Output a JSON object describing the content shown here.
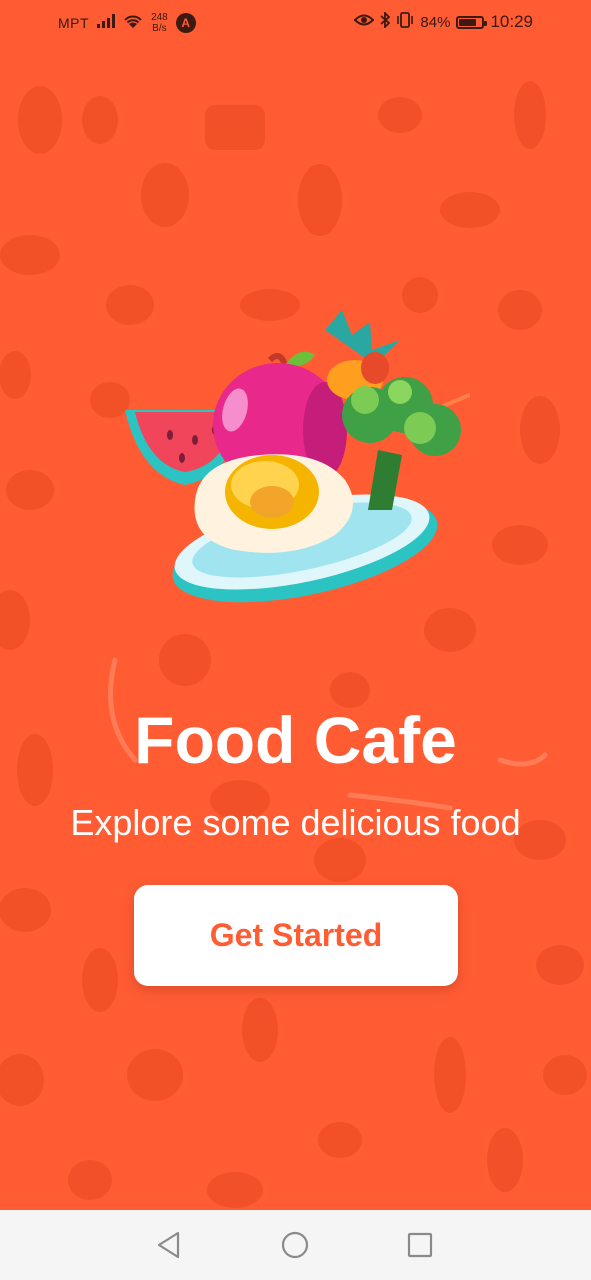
{
  "status_bar": {
    "carrier": "MPT",
    "speed_value": "248",
    "speed_unit": "B/s",
    "app_badge": "A",
    "battery_percent": "84%",
    "battery_level": 0.84,
    "time": "10:29",
    "icons": [
      "signal-icon",
      "wifi-icon",
      "eye-icon",
      "bluetooth-icon",
      "vibrate-icon",
      "battery-icon"
    ]
  },
  "hero": {
    "icon": "food-plate-illustration"
  },
  "main": {
    "title": "Food Cafe",
    "subtitle": "Explore some delicious food",
    "cta_label": "Get Started"
  },
  "nav_bar": {
    "buttons": [
      "back-icon",
      "home-icon",
      "recents-icon"
    ]
  },
  "colors": {
    "background": "#FF5C33",
    "button_bg": "#FFFFFF",
    "button_text": "#FF5C33",
    "nav_bg": "#F5F5F5"
  }
}
